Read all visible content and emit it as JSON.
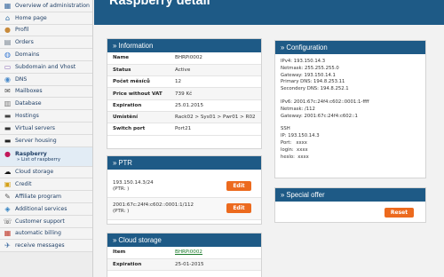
{
  "sidebar": {
    "items": [
      {
        "label": "Overview of administration",
        "icon": "dashboard-icon"
      },
      {
        "label": "Home page",
        "icon": "home-icon"
      },
      {
        "label": "Profil",
        "icon": "user-icon"
      },
      {
        "label": "Orders",
        "icon": "document-icon"
      },
      {
        "label": "Domains",
        "icon": "globe-icon"
      },
      {
        "label": "Subdomain and Vhost",
        "icon": "subdomain-icon"
      },
      {
        "label": "DNS",
        "icon": "dns-icon"
      },
      {
        "label": "Mailboxes",
        "icon": "mail-icon"
      },
      {
        "label": "Database",
        "icon": "database-icon"
      },
      {
        "label": "Hostings",
        "icon": "hosting-icon"
      },
      {
        "label": "Virtual servers",
        "icon": "server-icon"
      },
      {
        "label": "Server housing",
        "icon": "rack-icon"
      },
      {
        "label": "Raspberry",
        "icon": "raspberry-icon",
        "sub": "» List of raspberry",
        "active": true
      },
      {
        "label": "Cloud storage",
        "icon": "cloud-icon"
      },
      {
        "label": "Credit",
        "icon": "lock-icon"
      },
      {
        "label": "Affiliate program",
        "icon": "affiliate-icon"
      },
      {
        "label": "Additional services",
        "icon": "services-icon"
      },
      {
        "label": "Customer support",
        "icon": "support-icon"
      },
      {
        "label": "automatic billing",
        "icon": "billing-icon"
      },
      {
        "label": "receive messages",
        "icon": "message-icon"
      }
    ]
  },
  "header": {
    "title": "Raspberry detail"
  },
  "information": {
    "title": "Information",
    "rows": [
      {
        "k": "Name",
        "v": "BHRPi0002"
      },
      {
        "k": "Status",
        "v": "Active"
      },
      {
        "k": "Počet měsíců",
        "v": "12"
      },
      {
        "k": "Price without VAT",
        "v": "739 Kč"
      },
      {
        "k": "Expiration",
        "v": "25.01.2015"
      },
      {
        "k": "Umístění",
        "v": "Rack02 > Sys01 > Pwr01 > R02"
      },
      {
        "k": "Switch port",
        "v": "Port21"
      }
    ]
  },
  "ptr": {
    "title": "PTR",
    "rows": [
      {
        "line1": "193.150.14.3/24",
        "line2": "(PTR: )"
      },
      {
        "line1": "2001:67c:24f4:c602::0001:1/112",
        "line2": "(PTR: )"
      }
    ],
    "edit_label": "Edit"
  },
  "cloud": {
    "title": "Cloud storage",
    "rows": [
      {
        "k": "Item",
        "v": "BHRPi0002"
      },
      {
        "k": "Expiration",
        "v": "25-01-2015"
      }
    ]
  },
  "configuration": {
    "title": "Configuration",
    "ipv4_lines": [
      "IPv4: 193.150.14.3",
      "Netmask: 255.255.255.0",
      "Gateway: 193.150.14.1",
      "Primary DNS: 194.8.253.11",
      "Secondery DNS: 194.8.252.1"
    ],
    "ipv6_lines": [
      "IPv6: 2001:67c:24f4:c602::0001:1-ffff",
      "Netmask: /112",
      "Gateway: 2001:67c:24f4:c602::1"
    ],
    "ssh_lines": [
      "SSH",
      "IP: 193.150.14.3",
      "Port:   xxxx",
      "login:  xxxx",
      "heslo:  xxxx"
    ]
  },
  "special_offer": {
    "title": "Special offer",
    "reset_label": "Reset"
  }
}
